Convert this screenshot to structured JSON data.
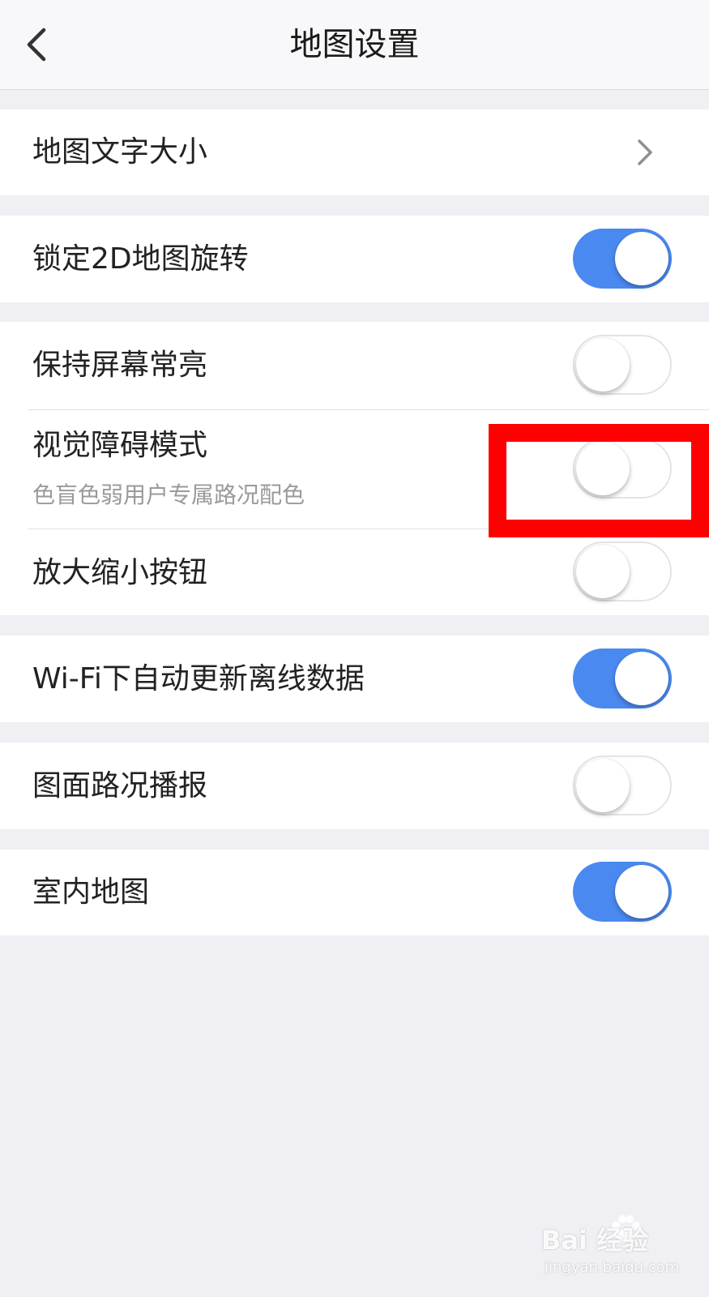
{
  "header": {
    "title": "地图设置",
    "back_icon": "chevron-left-icon"
  },
  "settings": {
    "text_size": {
      "label": "地图文字大小",
      "icon": "chevron-right-icon"
    },
    "lock_2d_rotation": {
      "label": "锁定2D地图旋转",
      "enabled": true
    },
    "keep_screen_on": {
      "label": "保持屏幕常亮",
      "enabled": false
    },
    "visual_impairment_mode": {
      "label": "视觉障碍模式",
      "description": "色盲色弱用户专属路况配色",
      "enabled": false
    },
    "zoom_buttons": {
      "label": "放大缩小按钮",
      "enabled": false
    },
    "wifi_offline_update": {
      "label": "Wi-Fi下自动更新离线数据",
      "enabled": true
    },
    "traffic_broadcast": {
      "label": "图面路况播报",
      "enabled": false
    },
    "indoor_map": {
      "label": "室内地图",
      "enabled": true
    }
  },
  "colors": {
    "toggle_on": "#4a89f0",
    "page_background": "#efeff4",
    "highlight_box": "#ff0000"
  },
  "watermark": {
    "brand": "Bai  经验",
    "url": "jingyan.baidu.com"
  }
}
